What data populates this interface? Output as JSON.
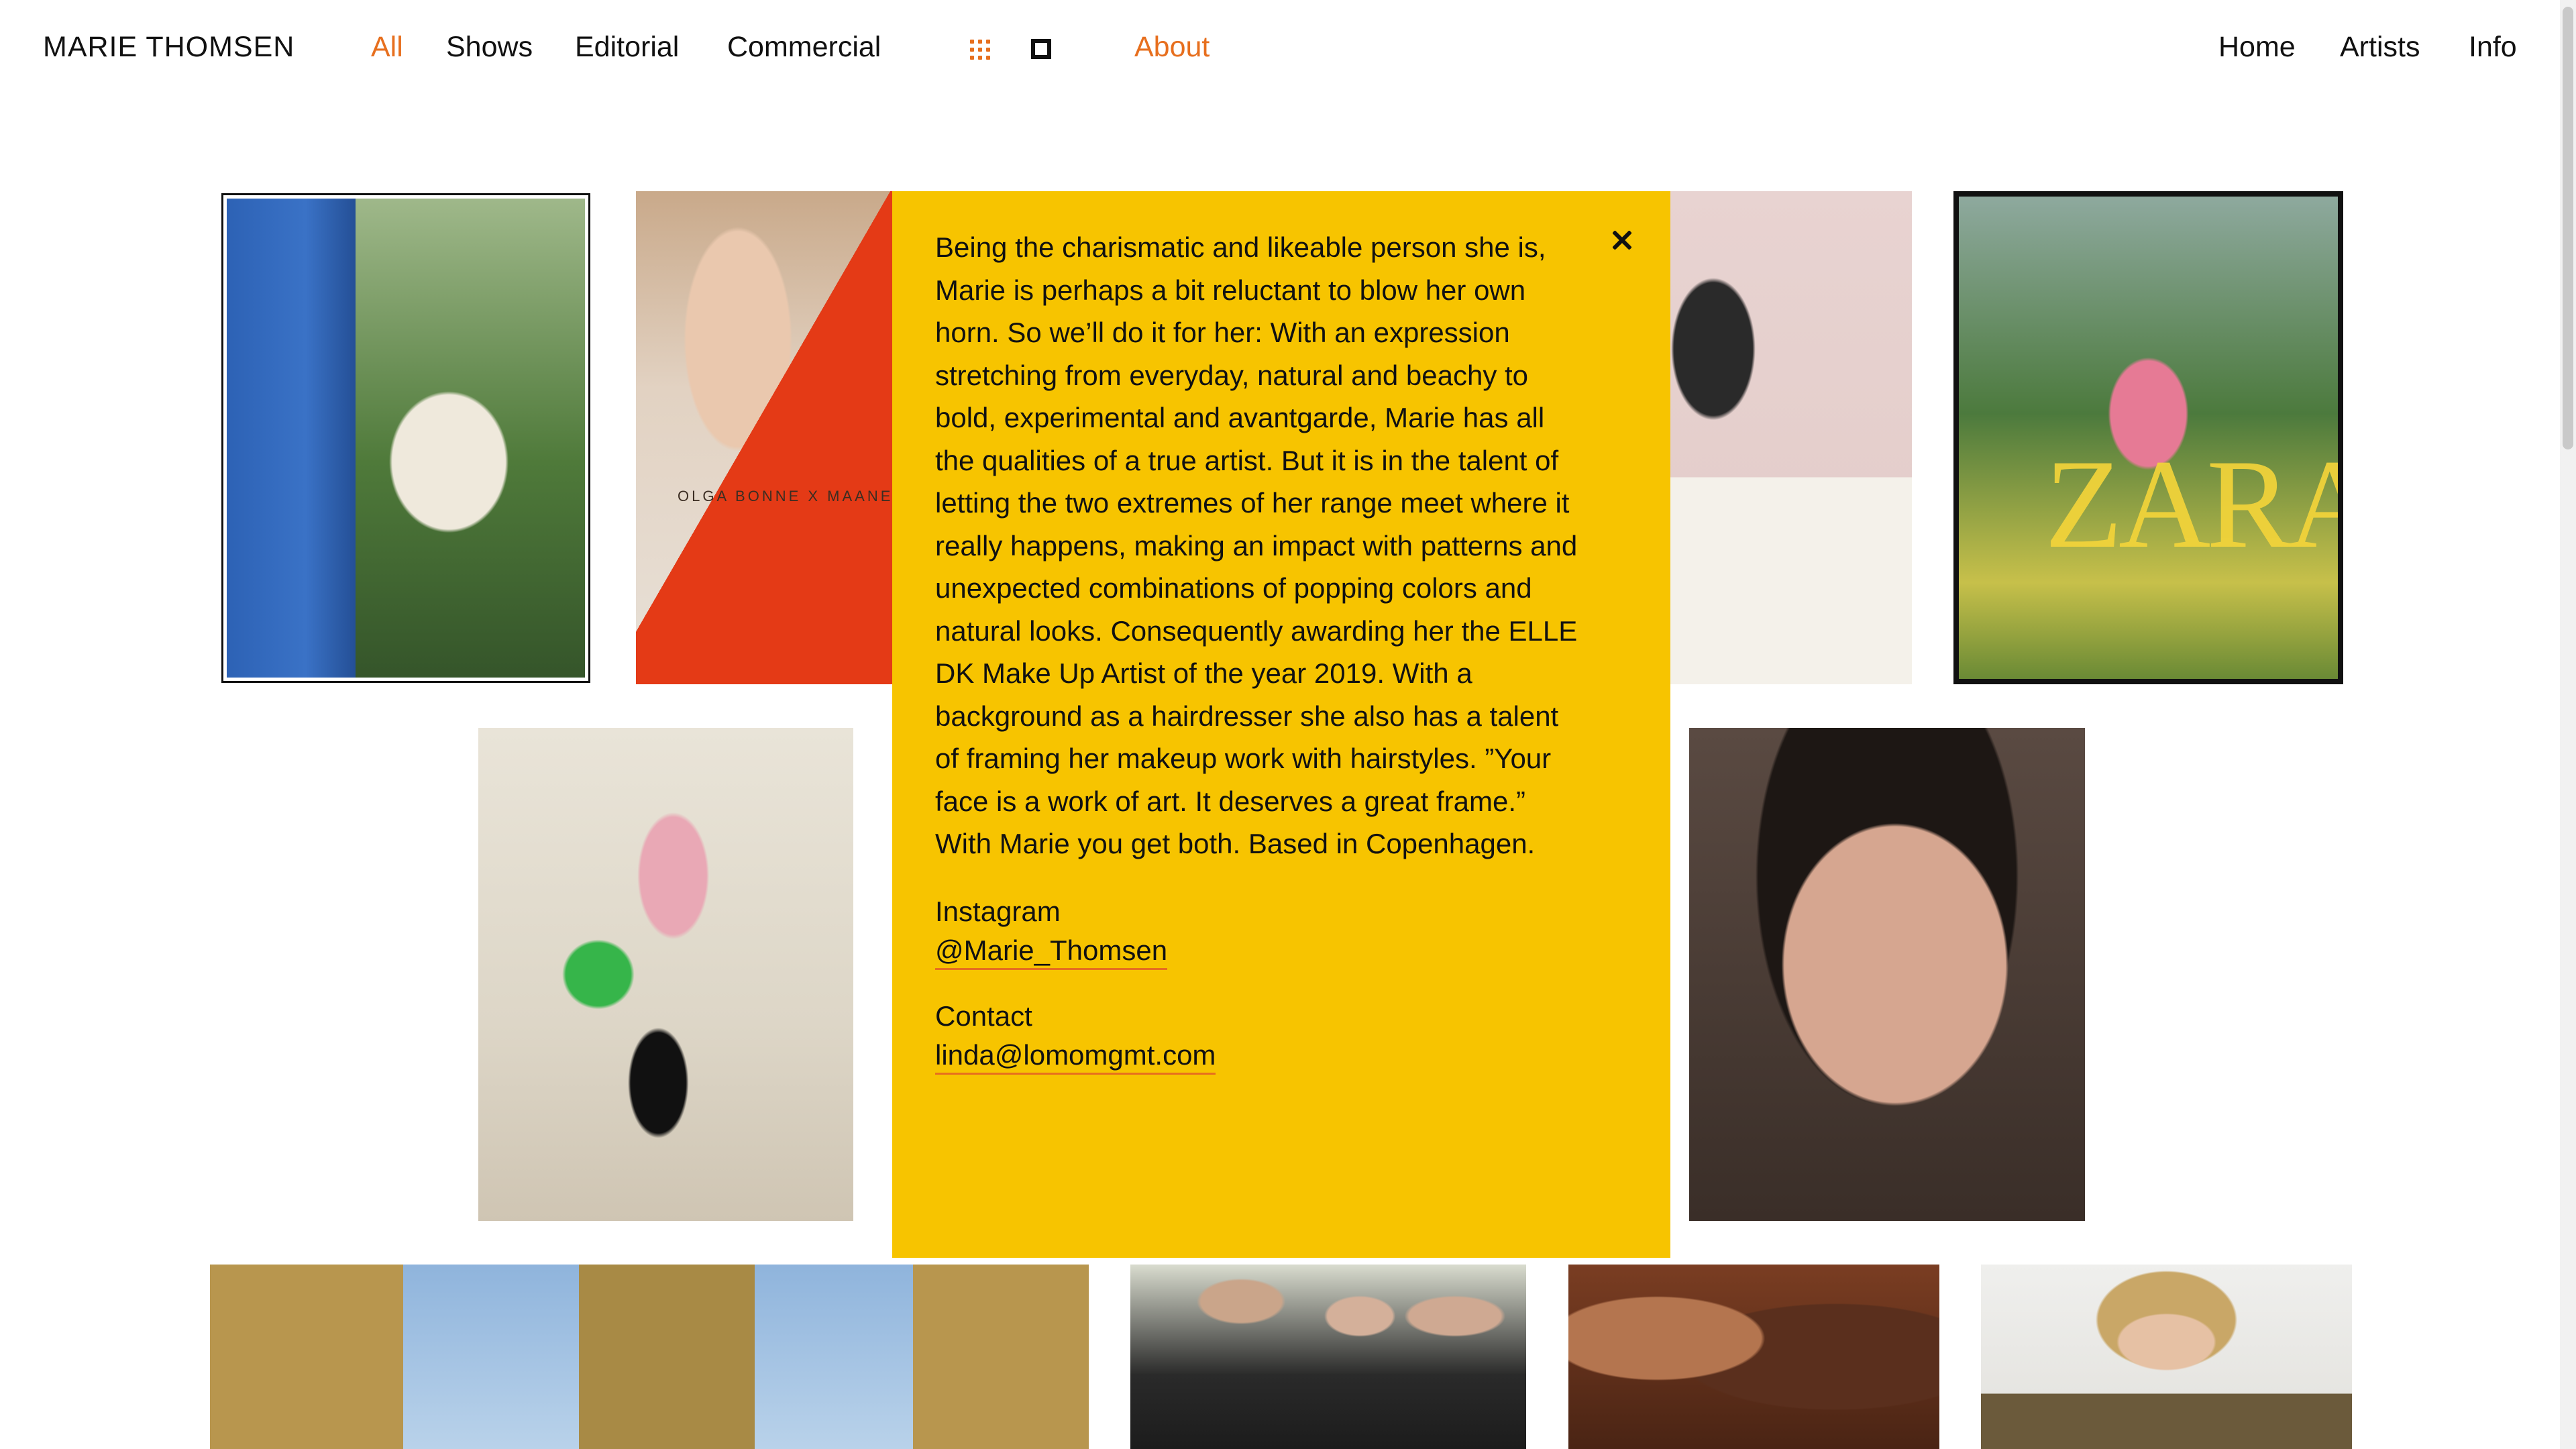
{
  "header": {
    "site_title": "MARIE THOMSEN",
    "nav_left": [
      {
        "label": "All",
        "active": true
      },
      {
        "label": "Shows",
        "active": false
      },
      {
        "label": "Editorial",
        "active": false
      },
      {
        "label": "Commercial",
        "active": false
      }
    ],
    "view_icons": [
      "grid-view-icon",
      "single-view-icon"
    ],
    "about_label": "About",
    "nav_right": [
      "Home",
      "Artists",
      "Info"
    ],
    "colors": {
      "accent": "#e76f1e",
      "panel": "#f7c400",
      "text": "#111111"
    }
  },
  "gallery": {
    "overlays": {
      "campaign_text": "OLGA BONNE X MAANES",
      "brand_logo": "ZARA"
    }
  },
  "about_panel": {
    "close_icon": "close-icon",
    "bio": "Being the charismatic and likeable person she is, Marie is perhaps a bit reluctant to blow her own horn. So we’ll do it for her: With an expression stretching from everyday, natural and beachy to bold, experimental and avantgarde, Marie has all the qualities of a true artist. But it is in the talent of letting the two extremes of her range meet where it really happens, making an impact with patterns and unexpected combinations of popping colors and natural looks. Consequently awarding her the ELLE DK Make Up Artist of the year 2019. With a background as a hairdresser she also has a talent of framing her makeup work with hairstyles. ”Your face is a work of art. It deserves a great frame.” With Marie you get both. Based in Copenhagen.",
    "instagram_label": "Instagram",
    "instagram_handle": "@Marie_Thomsen",
    "contact_label": "Contact",
    "contact_email": "linda@lomomgmt.com"
  }
}
